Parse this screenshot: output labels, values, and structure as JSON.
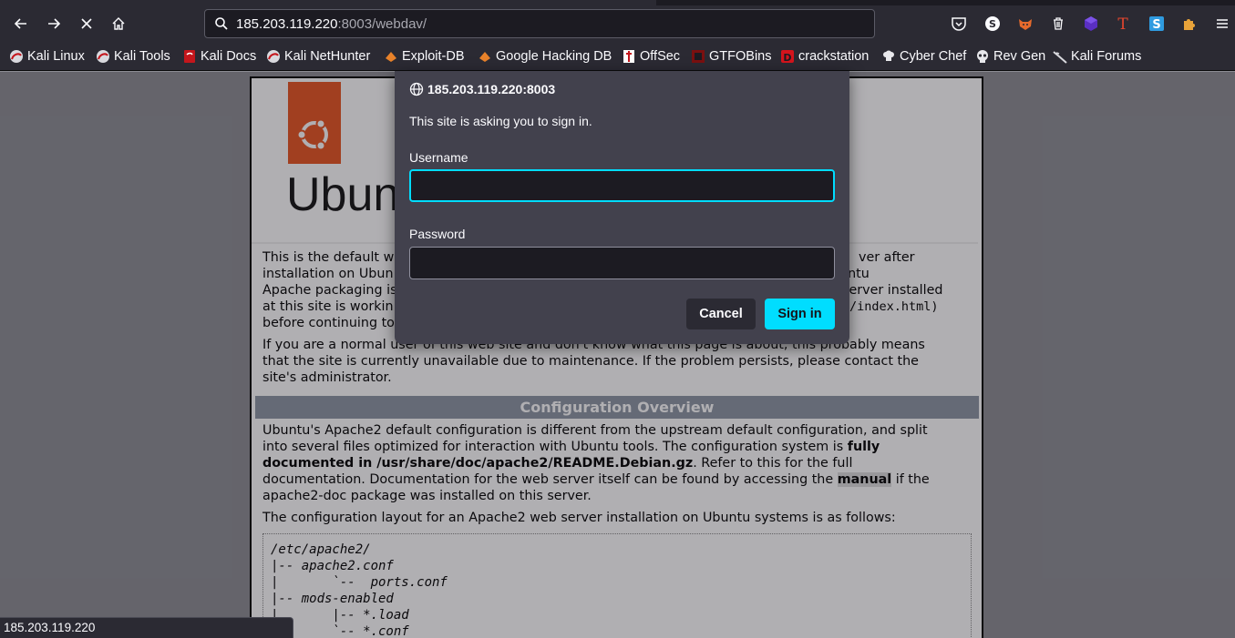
{
  "browser": {
    "url_host": "185.203.119.220",
    "url_rest": ":8003/webdav/",
    "status_text": "185.203.119.220"
  },
  "bookmarks": [
    {
      "label": "Kali Linux",
      "icon": "kali-dragon-icon"
    },
    {
      "label": "Kali Tools",
      "icon": "kali-dragon-icon"
    },
    {
      "label": "Kali Docs",
      "icon": "kali-docs-icon"
    },
    {
      "label": "Kali NetHunter",
      "icon": "kali-dragon-icon"
    },
    {
      "label": "Exploit-DB",
      "icon": "exploit-db-icon"
    },
    {
      "label": "Google Hacking DB",
      "icon": "ghdb-icon"
    },
    {
      "label": "OffSec",
      "icon": "offsec-icon"
    },
    {
      "label": "GTFOBins",
      "icon": "gtfobins-icon"
    },
    {
      "label": "crackstation",
      "icon": "crackstation-icon"
    },
    {
      "label": "Cyber Chef",
      "icon": "chef-hat-icon"
    },
    {
      "label": "Rev Gen",
      "icon": "skull-icon"
    },
    {
      "label": "Kali Forums",
      "icon": "kali-dragon-icon"
    }
  ],
  "dialog": {
    "origin": "185.203.119.220:8003",
    "message": "This site is asking you to sign in.",
    "username_label": "Username",
    "username_value": "",
    "password_label": "Password",
    "password_value": "",
    "cancel_label": "Cancel",
    "signin_label": "Sign in"
  },
  "page": {
    "ubuntu_word": "Ubuntu",
    "p1_lines": [
      "This is the default w",
      "installation on Ubun",
      "Apache packaging is",
      "at this site is workin",
      "before continuing to"
    ],
    "p1_right": [
      "ver after",
      "ch the Ubuntu",
      "server installed",
      "/index.html)"
    ],
    "p2_lines": [
      "If you are a normal user of this web site and don't know what this page is about, this probably means",
      "that the site is currently unavailable due to maintenance. If the problem persists, please contact the",
      "site's administrator."
    ],
    "section_title": "Configuration Overview",
    "p3_a": "Ubuntu's Apache2 default configuration is different from the upstream default configuration, and split",
    "p3_b1": "into several files optimized for interaction with Ubuntu tools. The configuration system is ",
    "p3_b2": "fully",
    "p3_c": "documented in /usr/share/doc/apache2/README.Debian.gz",
    "p3_c2": ". Refer to this for the full",
    "p3_d1": "documentation. Documentation for the web server itself can be found by accessing the ",
    "p3_d2": "manual",
    "p3_d3": " if the",
    "p3_e": "apache2-doc package was installed on this server.",
    "p4": "The configuration layout for an Apache2 web server installation on Ubuntu systems is as follows:",
    "tree": "/etc/apache2/\n|-- apache2.conf\n|       `--  ports.conf\n|-- mods-enabled\n|       |-- *.load\n|       `-- *.conf"
  }
}
